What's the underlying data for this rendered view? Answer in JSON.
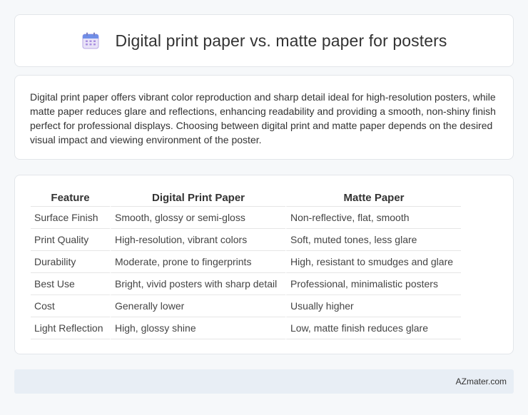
{
  "header": {
    "title": "Digital print paper vs. matte paper for posters",
    "icon": "calendar-icon"
  },
  "description": "Digital print paper offers vibrant color reproduction and sharp detail ideal for high-resolution posters, while matte paper reduces glare and reflections, enhancing readability and providing a smooth, non-shiny finish perfect for professional displays. Choosing between digital print and matte paper depends on the desired visual impact and viewing environment of the poster.",
  "table": {
    "headers": [
      "Feature",
      "Digital Print Paper",
      "Matte Paper"
    ],
    "rows": [
      [
        "Surface Finish",
        "Smooth, glossy or semi-gloss",
        "Non-reflective, flat, smooth"
      ],
      [
        "Print Quality",
        "High-resolution, vibrant colors",
        "Soft, muted tones, less glare"
      ],
      [
        "Durability",
        "Moderate, prone to fingerprints",
        "High, resistant to smudges and glare"
      ],
      [
        "Best Use",
        "Bright, vivid posters with sharp detail",
        "Professional, minimalistic posters"
      ],
      [
        "Cost",
        "Generally lower",
        "Usually higher"
      ],
      [
        "Light Reflection",
        "High, glossy shine",
        "Low, matte finish reduces glare"
      ]
    ]
  },
  "footer": {
    "brand": "AZmater.com"
  }
}
